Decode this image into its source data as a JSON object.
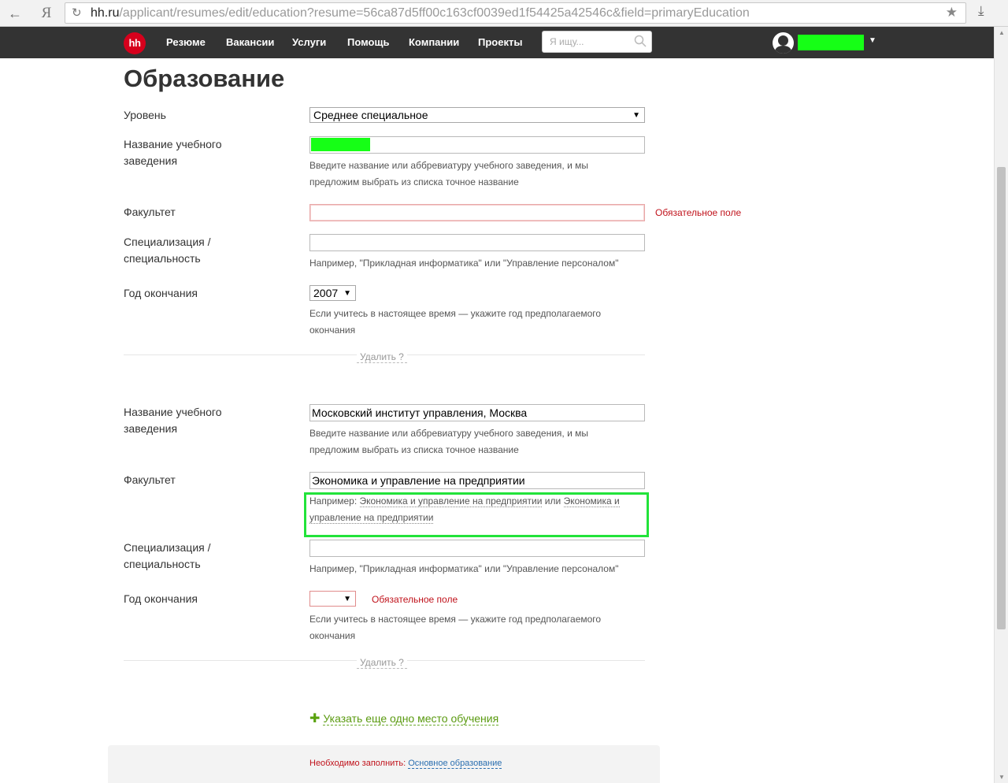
{
  "browser": {
    "url_host": "hh.ru",
    "url_path": "/applicant/resumes/edit/education?resume=56ca87d5ff00c163cf0039ed1f54425a42546c&field=primaryEducation",
    "yandex_glyph": "Я"
  },
  "header": {
    "logo": "hh",
    "menu": [
      "Резюме",
      "Вакансии",
      "Услуги",
      "Помощь",
      "Компании",
      "Проекты"
    ],
    "search_placeholder": "Я ищу..."
  },
  "page": {
    "title": "Образование"
  },
  "form": {
    "level_label": "Уровень",
    "level_value": "Среднее специальное",
    "required_text": "Обязательное поле",
    "delete_label": "Удалить ?",
    "entries": [
      {
        "institution_label": "Название учебного заведения",
        "institution_value": "",
        "institution_hint": "Введите название или аббревиатуру учебного заведения, и мы предложим выбрать из списка точное название",
        "faculty_label": "Факультет",
        "faculty_value": "",
        "specialization_label": "Специализация / специальность",
        "specialization_value": "",
        "specialization_hint": "Например, \"Прикладная информатика\" или \"Управление персоналом\"",
        "year_label": "Год окончания",
        "year_value": "2007",
        "year_hint": "Если учитесь в настоящее время — укажите год предполагаемого окончания"
      },
      {
        "institution_label": "Название учебного заведения",
        "institution_value": "Московский институт управления, Москва",
        "institution_hint": "Введите название или аббревиатуру учебного заведения, и мы предложим выбрать из списка точное название",
        "faculty_label": "Факультет",
        "faculty_value": "Экономика и управление на предприятии",
        "faculty_hint_prefix": "Например:",
        "faculty_suggestion_1": "Экономика и управление на предприятии",
        "faculty_hint_or": "или",
        "faculty_suggestion_2": "Экономика и управление на предприятии",
        "specialization_label": "Специализация / специальность",
        "specialization_value": "",
        "specialization_hint": "Например, \"Прикладная информатика\" или \"Управление персоналом\"",
        "year_label": "Год окончания",
        "year_value": "",
        "year_hint": "Если учитесь в настоящее время — укажите год предполагаемого окончания"
      }
    ],
    "add_more_label": "Указать еще одно место обучения"
  },
  "footer": {
    "required_prefix": "Необходимо заполнить:",
    "required_link": "Основное образование"
  },
  "colors": {
    "header_bg": "#333333",
    "brand_red": "#d6001c",
    "error_red": "#c0121b",
    "highlight_green": "#22e33a",
    "redaction_green": "#16ff16",
    "add_link_green": "#5a9a10"
  },
  "icons": [
    "back-arrow-icon",
    "reload-icon",
    "star-icon",
    "download-icon",
    "search-icon",
    "avatar-icon",
    "caret-down-icon",
    "plus-icon"
  ]
}
